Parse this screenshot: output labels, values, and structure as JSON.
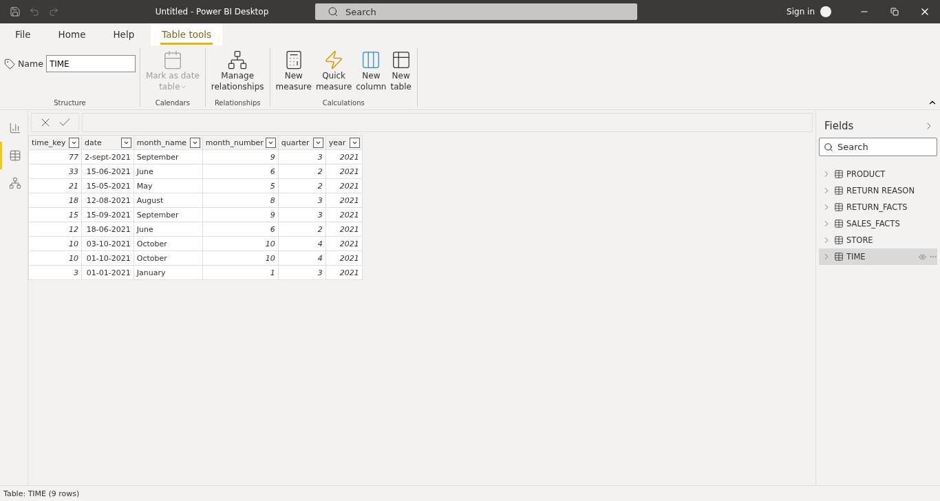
{
  "window": {
    "title": "Untitled - Power BI Desktop",
    "search_placeholder": "Search",
    "sign_in": "Sign in"
  },
  "ribbon_tabs": [
    {
      "label": "File",
      "selected": false
    },
    {
      "label": "Home",
      "selected": false
    },
    {
      "label": "Help",
      "selected": false
    },
    {
      "label": "Table tools",
      "selected": true
    }
  ],
  "ribbon_groups": [
    {
      "title": "Structure",
      "name_label": "Name",
      "name_value": "TIME"
    },
    {
      "title": "Calendars",
      "buttons": [
        {
          "kind": "calendar",
          "lines": [
            "Mark as date",
            "table"
          ],
          "disabled": true,
          "dropdown": true
        }
      ]
    },
    {
      "title": "Relationships",
      "buttons": [
        {
          "kind": "relationships",
          "lines": [
            "Manage",
            "relationships"
          ],
          "disabled": false
        }
      ]
    },
    {
      "title": "Calculations",
      "buttons": [
        {
          "kind": "measure",
          "lines": [
            "New",
            "measure"
          ],
          "disabled": false
        },
        {
          "kind": "quick",
          "lines": [
            "Quick",
            "measure"
          ],
          "disabled": false
        },
        {
          "kind": "column",
          "lines": [
            "New",
            "column"
          ],
          "disabled": false
        },
        {
          "kind": "table",
          "lines": [
            "New",
            "table"
          ],
          "disabled": false
        }
      ]
    }
  ],
  "nav": [
    {
      "kind": "report",
      "selected": false
    },
    {
      "kind": "data",
      "selected": true
    },
    {
      "kind": "model",
      "selected": false
    }
  ],
  "table": {
    "columns": [
      {
        "label": "time_key",
        "kind": "number"
      },
      {
        "label": "date",
        "kind": "date"
      },
      {
        "label": "month_name",
        "kind": "text"
      },
      {
        "label": "month_number",
        "kind": "number"
      },
      {
        "label": "quarter",
        "kind": "number"
      },
      {
        "label": "year",
        "kind": "number"
      }
    ],
    "rows": [
      [
        "77",
        "2-sept-2021",
        "September",
        "9",
        "3",
        "2021"
      ],
      [
        "33",
        "15-06-2021",
        "June",
        "6",
        "2",
        "2021"
      ],
      [
        "21",
        "15-05-2021",
        "May",
        "5",
        "2",
        "2021"
      ],
      [
        "18",
        "12-08-2021",
        "August",
        "8",
        "3",
        "2021"
      ],
      [
        "15",
        "15-09-2021",
        "September",
        "9",
        "3",
        "2021"
      ],
      [
        "12",
        "18-06-2021",
        "June",
        "6",
        "2",
        "2021"
      ],
      [
        "10",
        "03-10-2021",
        "October",
        "10",
        "4",
        "2021"
      ],
      [
        "10",
        "01-10-2021",
        "October",
        "10",
        "4",
        "2021"
      ],
      [
        "3",
        "01-01-2021",
        "January",
        "1",
        "3",
        "2021"
      ]
    ]
  },
  "fields": {
    "title": "Fields",
    "search_placeholder": "Search",
    "items": [
      {
        "label": "PRODUCT",
        "selected": false
      },
      {
        "label": "RETURN REASON",
        "selected": false
      },
      {
        "label": "RETURN_FACTS",
        "selected": false
      },
      {
        "label": "SALES_FACTS",
        "selected": false
      },
      {
        "label": "STORE",
        "selected": false
      },
      {
        "label": "TIME",
        "selected": true
      }
    ]
  },
  "status_bar": "Table: TIME (9 rows)"
}
